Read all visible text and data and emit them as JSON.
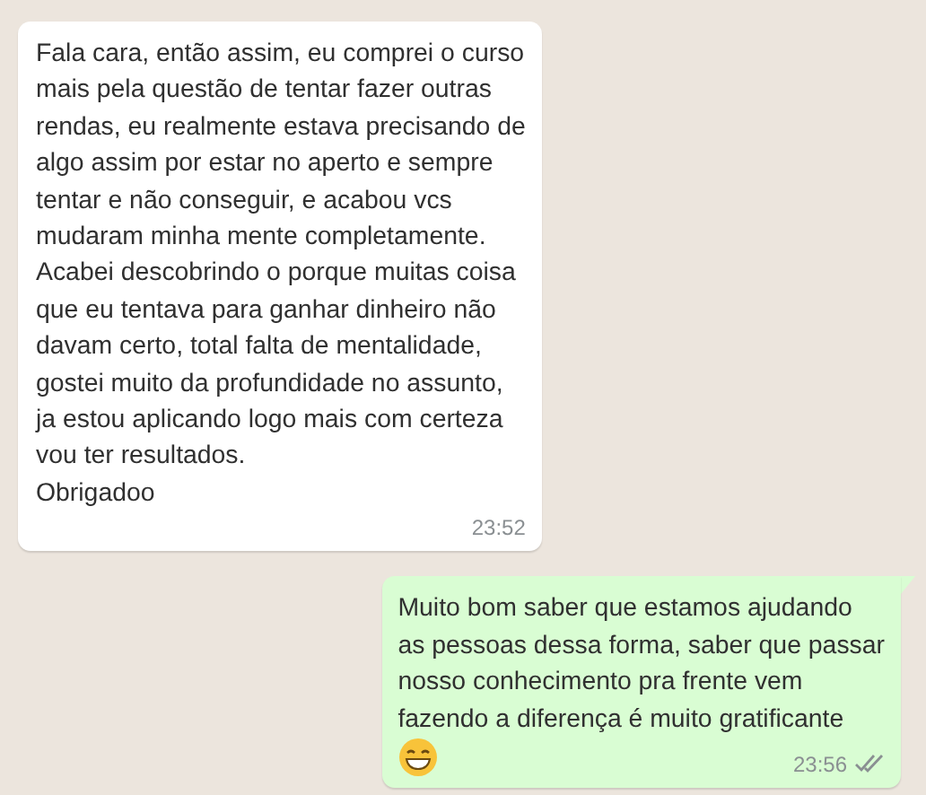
{
  "messages": [
    {
      "kind": "incoming",
      "text": "Fala cara, então assim, eu comprei o curso\nmais pela questão de tentar fazer outras\nrendas, eu realmente estava precisando de\nalgo assim por estar no aperto e sempre\ntentar e não conseguir, e acabou vcs\nmudaram minha mente completamente.\nAcabei descobrindo o porque muitas coisa\nque eu tentava para ganhar dinheiro não\ndavam certo, total falta de mentalidade,\ngostei muito da profundidade no assunto,\nja estou aplicando logo mais com certeza\nvou ter resultados.\nObrigadoo",
      "time": "23:52"
    },
    {
      "kind": "outgoing",
      "text": "Muito bom saber que estamos ajudando\nas pessoas dessa forma, saber que passar\nnosso conhecimento pra frente vem\nfazendo a diferença é muito gratificante",
      "emoji": true,
      "time": "23:56",
      "read": false
    }
  ]
}
